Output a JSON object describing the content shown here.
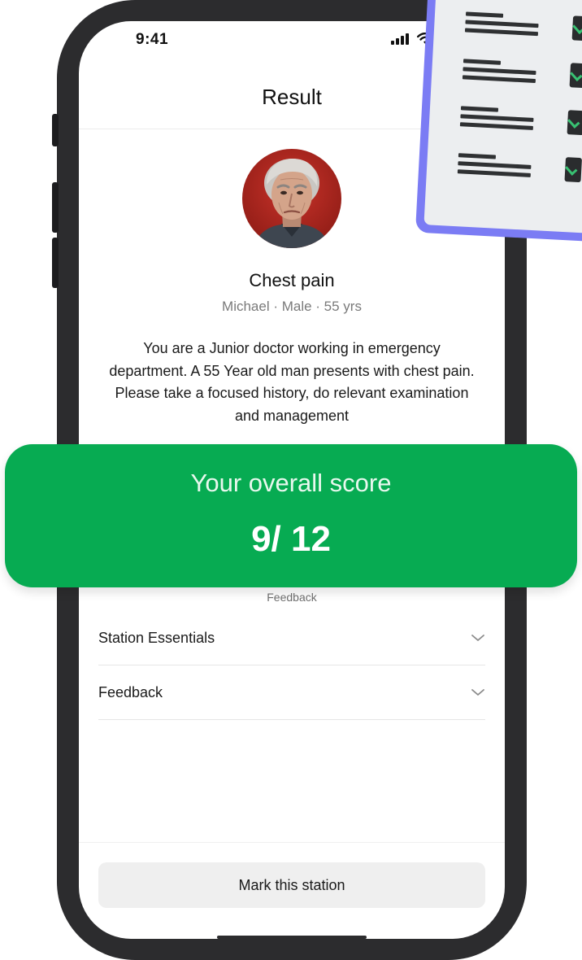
{
  "status_bar": {
    "time": "9:41"
  },
  "header": {
    "title": "Result"
  },
  "case": {
    "title": "Chest pain",
    "meta": "Michael · Male · 55 yrs",
    "description": "You are a Junior doctor working in emergency department. A 55 Year old man presents with chest pain. Please take a focused history, do relevant examination and management"
  },
  "score": {
    "label": "Your overall score",
    "value": "9/ 12"
  },
  "feedback_caption": "Feedback",
  "accordion": [
    {
      "label": "Station Essentials",
      "icon": "chevron-down-icon"
    },
    {
      "label": "Feedback",
      "icon": "chevron-down-icon"
    }
  ],
  "actions": {
    "mark_label": "Mark this station"
  },
  "colors": {
    "score_green": "#07ab52",
    "checklist_purple": "#7b7cf4",
    "avatar_bg": "#b3261e"
  }
}
